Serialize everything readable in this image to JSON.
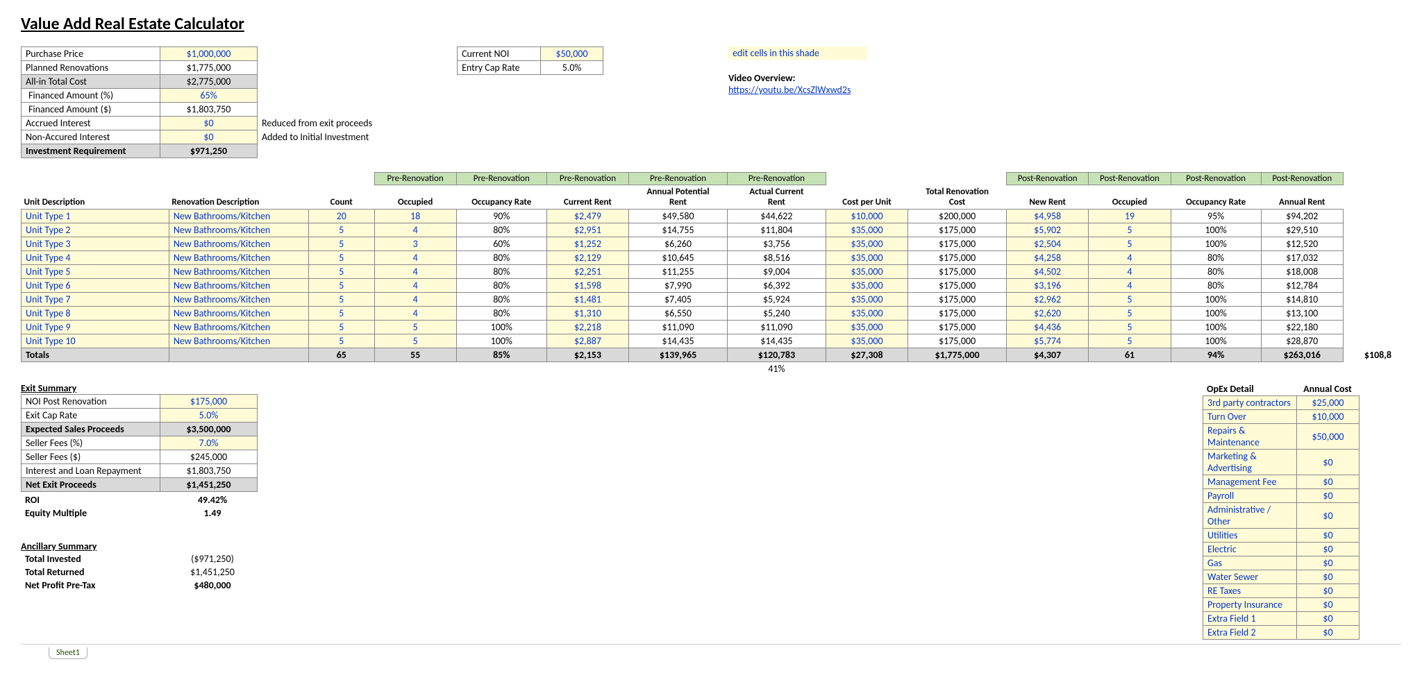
{
  "title": "Value Add Real Estate Calculator",
  "editNote": "edit cells in this shade",
  "videoOverview": {
    "label": "Video Overview:",
    "url": "https://youtu.be/XcsZlWxwd2s"
  },
  "summary": {
    "purchasePriceLabel": "Purchase Price",
    "purchasePrice": "$1,000,000",
    "plannedRenoLabel": "Planned Renovations",
    "plannedReno": "$1,775,000",
    "allInLabel": "All-in Total Cost",
    "allIn": "$2,775,000",
    "finPctLabel": "Financed Amount (%)",
    "finPct": "65%",
    "finDollarLabel": "Financed Amount ($)",
    "finDollar": "$1,803,750",
    "accruedIntLabel": "Accrued Interest",
    "accruedInt": "$0",
    "accruedIntNote": "Reduced from exit proceeds",
    "nonAccruedLabel": "Non-Accured Interest",
    "nonAccrued": "$0",
    "nonAccruedNote": "Added to Initial Investment",
    "invReqLabel": "Investment Requirement",
    "invReq": "$971,250"
  },
  "noi": {
    "currentNOILabel": "Current NOI",
    "currentNOI": "$50,000",
    "entryCapLabel": "Entry Cap Rate",
    "entryCap": "5.0%"
  },
  "headers": {
    "unitDesc": "Unit Description",
    "renoDesc": "Renovation Description",
    "count": "Count",
    "occupied": "Occupied",
    "occRate": "Occupancy Rate",
    "curRent": "Current Rent",
    "annPotRent": "Annual Potential Rent",
    "actCurRent": "Actual Current Rent",
    "costPerUnit": "Cost per Unit",
    "totRenoCost": "Total Renovation Cost",
    "newRent": "New Rent",
    "occupied2": "Occupied",
    "occRate2": "Occupancy Rate",
    "annRent": "Annual Rent",
    "preReno": "Pre-Renovation",
    "postReno": "Post-Renovation"
  },
  "units": [
    {
      "desc": "Unit Type 1",
      "reno": "New Bathrooms/Kitchen",
      "count": "20",
      "occ": "18",
      "rate": "90%",
      "curRent": "$2,479",
      "annPot": "$49,580",
      "actCur": "$44,622",
      "cpu": "$10,000",
      "trc": "$200,000",
      "newRent": "$4,958",
      "occ2": "19",
      "rate2": "95%",
      "annRent": "$94,202"
    },
    {
      "desc": "Unit Type 2",
      "reno": "New Bathrooms/Kitchen",
      "count": "5",
      "occ": "4",
      "rate": "80%",
      "curRent": "$2,951",
      "annPot": "$14,755",
      "actCur": "$11,804",
      "cpu": "$35,000",
      "trc": "$175,000",
      "newRent": "$5,902",
      "occ2": "5",
      "rate2": "100%",
      "annRent": "$29,510"
    },
    {
      "desc": "Unit Type 3",
      "reno": "New Bathrooms/Kitchen",
      "count": "5",
      "occ": "3",
      "rate": "60%",
      "curRent": "$1,252",
      "annPot": "$6,260",
      "actCur": "$3,756",
      "cpu": "$35,000",
      "trc": "$175,000",
      "newRent": "$2,504",
      "occ2": "5",
      "rate2": "100%",
      "annRent": "$12,520"
    },
    {
      "desc": "Unit Type 4",
      "reno": "New Bathrooms/Kitchen",
      "count": "5",
      "occ": "4",
      "rate": "80%",
      "curRent": "$2,129",
      "annPot": "$10,645",
      "actCur": "$8,516",
      "cpu": "$35,000",
      "trc": "$175,000",
      "newRent": "$4,258",
      "occ2": "4",
      "rate2": "80%",
      "annRent": "$17,032"
    },
    {
      "desc": "Unit Type 5",
      "reno": "New Bathrooms/Kitchen",
      "count": "5",
      "occ": "4",
      "rate": "80%",
      "curRent": "$2,251",
      "annPot": "$11,255",
      "actCur": "$9,004",
      "cpu": "$35,000",
      "trc": "$175,000",
      "newRent": "$4,502",
      "occ2": "4",
      "rate2": "80%",
      "annRent": "$18,008"
    },
    {
      "desc": "Unit Type 6",
      "reno": "New Bathrooms/Kitchen",
      "count": "5",
      "occ": "4",
      "rate": "80%",
      "curRent": "$1,598",
      "annPot": "$7,990",
      "actCur": "$6,392",
      "cpu": "$35,000",
      "trc": "$175,000",
      "newRent": "$3,196",
      "occ2": "4",
      "rate2": "80%",
      "annRent": "$12,784"
    },
    {
      "desc": "Unit Type 7",
      "reno": "New Bathrooms/Kitchen",
      "count": "5",
      "occ": "4",
      "rate": "80%",
      "curRent": "$1,481",
      "annPot": "$7,405",
      "actCur": "$5,924",
      "cpu": "$35,000",
      "trc": "$175,000",
      "newRent": "$2,962",
      "occ2": "5",
      "rate2": "100%",
      "annRent": "$14,810"
    },
    {
      "desc": "Unit Type 8",
      "reno": "New Bathrooms/Kitchen",
      "count": "5",
      "occ": "4",
      "rate": "80%",
      "curRent": "$1,310",
      "annPot": "$6,550",
      "actCur": "$5,240",
      "cpu": "$35,000",
      "trc": "$175,000",
      "newRent": "$2,620",
      "occ2": "5",
      "rate2": "100%",
      "annRent": "$13,100"
    },
    {
      "desc": "Unit Type 9",
      "reno": "New Bathrooms/Kitchen",
      "count": "5",
      "occ": "5",
      "rate": "100%",
      "curRent": "$2,218",
      "annPot": "$11,090",
      "actCur": "$11,090",
      "cpu": "$35,000",
      "trc": "$175,000",
      "newRent": "$4,436",
      "occ2": "5",
      "rate2": "100%",
      "annRent": "$22,180"
    },
    {
      "desc": "Unit Type 10",
      "reno": "New Bathrooms/Kitchen",
      "count": "5",
      "occ": "5",
      "rate": "100%",
      "curRent": "$2,887",
      "annPot": "$14,435",
      "actCur": "$14,435",
      "cpu": "$35,000",
      "trc": "$175,000",
      "newRent": "$5,774",
      "occ2": "5",
      "rate2": "100%",
      "annRent": "$28,870"
    }
  ],
  "totals": {
    "label": "Totals",
    "count": "65",
    "occ": "55",
    "rate": "85%",
    "curRent": "$2,153",
    "annPot": "$139,965",
    "actCur": "$120,783",
    "cpu": "$27,308",
    "trc": "$1,775,000",
    "newRent": "$4,307",
    "occ2": "61",
    "rate2": "94%",
    "annRent": "$263,016",
    "extra": "$108,8"
  },
  "belowTotals": {
    "pct41": "41%"
  },
  "exit": {
    "header": "Exit Summary",
    "noiPostLabel": "NOI Post Renovation",
    "noiPost": "$175,000",
    "exitCapLabel": "Exit Cap Rate",
    "exitCap": "5.0%",
    "expSalesLabel": "Expected Sales Proceeds",
    "expSales": "$3,500,000",
    "sellerFeesPctLabel": "Seller Fees (%)",
    "sellerFeesPct": "7.0%",
    "sellerFeesDLabel": "Seller Fees ($)",
    "sellerFeesD": "$245,000",
    "intLoanLabel": "Interest and Loan Repayment",
    "intLoan": "$1,803,750",
    "netExitLabel": "Net Exit Proceeds",
    "netExit": "$1,451,250",
    "roiLabel": "ROI",
    "roi": "49.42%",
    "eqMultLabel": "Equity Multiple",
    "eqMult": "1.49"
  },
  "ancillary": {
    "header": "Ancillary Summary",
    "totInvLabel": "Total Invested",
    "totInv": "($971,250)",
    "totRetLabel": "Total Returned",
    "totRet": "$1,451,250",
    "netProfitLabel": "Net Profit Pre-Tax",
    "netProfit": "$480,000"
  },
  "opex": {
    "header": "OpEx Detail",
    "cost": "Annual  Cost",
    "rows": [
      {
        "l": "3rd party contractors",
        "v": "$25,000"
      },
      {
        "l": "Turn Over",
        "v": "$10,000"
      },
      {
        "l": "Repairs & Maintenance",
        "v": "$50,000"
      },
      {
        "l": "Marketing & Advertising",
        "v": "$0"
      },
      {
        "l": "Management Fee",
        "v": "$0"
      },
      {
        "l": "Payroll",
        "v": "$0"
      },
      {
        "l": "Administrative / Other",
        "v": "$0"
      },
      {
        "l": "Utilities",
        "v": "$0"
      },
      {
        "l": "Electric",
        "v": "$0"
      },
      {
        "l": "Gas",
        "v": "$0"
      },
      {
        "l": "Water Sewer",
        "v": "$0"
      },
      {
        "l": "RE Taxes",
        "v": "$0"
      },
      {
        "l": "Property Insurance",
        "v": "$0"
      },
      {
        "l": "Extra Field 1",
        "v": "$0"
      },
      {
        "l": "Extra Field 2",
        "v": "$0"
      }
    ]
  },
  "sheetTab": "Sheet1"
}
